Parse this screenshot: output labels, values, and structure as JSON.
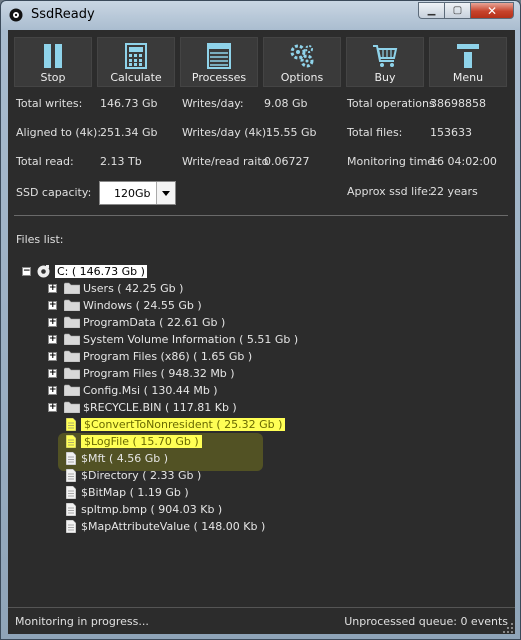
{
  "window": {
    "title": "SsdReady"
  },
  "toolbar": [
    {
      "label": "Stop",
      "icon": "pause-icon"
    },
    {
      "label": "Calculate",
      "icon": "calculator-icon"
    },
    {
      "label": "Processes",
      "icon": "list-icon"
    },
    {
      "label": "Options",
      "icon": "gears-icon"
    },
    {
      "label": "Buy",
      "icon": "cart-icon"
    },
    {
      "label": "Menu",
      "icon": "menu-icon"
    }
  ],
  "stats": {
    "total_writes": {
      "label": "Total writes:",
      "value": "146.73 Gb"
    },
    "writes_day": {
      "label": "Writes/day:",
      "value": "9.08 Gb"
    },
    "total_operations": {
      "label": "Total operations",
      "value": "38698858"
    },
    "aligned": {
      "label": "Aligned to (4k):",
      "value": "251.34 Gb"
    },
    "writes_day_4k": {
      "label": "Writes/day (4k):",
      "value": "15.55 Gb"
    },
    "total_files": {
      "label": "Total files:",
      "value": "153633"
    },
    "total_read": {
      "label": "Total read:",
      "value": "2.13 Tb"
    },
    "write_read_ratio": {
      "label": "Write/read raito",
      "value": "0.06727"
    },
    "monitoring_time": {
      "label": "Monitoring time:",
      "value": "16 04:02:00"
    },
    "ssd_capacity": {
      "label": "SSD capacity:",
      "value": "120Gb"
    },
    "approx_life": {
      "label": "Approx ssd life:",
      "value": "22 years"
    }
  },
  "files": {
    "label": "Files list:",
    "root": "C: ( 146.73 Gb )",
    "folders": [
      "Users ( 42.25 Gb )",
      "Windows ( 24.55 Gb )",
      "ProgramData ( 22.61 Gb )",
      "System Volume Information ( 5.51 Gb )",
      "Program Files (x86) ( 1.65 Gb )",
      "Program Files ( 948.32 Mb )",
      "Config.Msi ( 130.44 Mb )",
      "$RECYCLE.BIN ( 117.81 Kb )"
    ],
    "files": [
      {
        "name": "$ConvertToNonresident ( 25.32 Gb )",
        "highlight": true
      },
      {
        "name": "$LogFile ( 15.70 Gb )",
        "highlight": true
      },
      {
        "name": "$Mft ( 4.56 Gb )",
        "highlight": false
      },
      {
        "name": "$Directory ( 2.33 Gb )",
        "highlight": false
      },
      {
        "name": "$BitMap ( 1.19 Gb )",
        "highlight": false
      },
      {
        "name": "spltmp.bmp ( 904.03 Kb )",
        "highlight": false
      },
      {
        "name": "$MapAttributeValue ( 148.00 Kb )",
        "highlight": false
      }
    ]
  },
  "status": {
    "left": "Monitoring in progress...",
    "right": "Unprocessed queue: 0 events"
  },
  "colors": {
    "highlight": "#ffff55",
    "background": "#2c2c2c",
    "toolbar_icon": "#8fd3ea"
  }
}
